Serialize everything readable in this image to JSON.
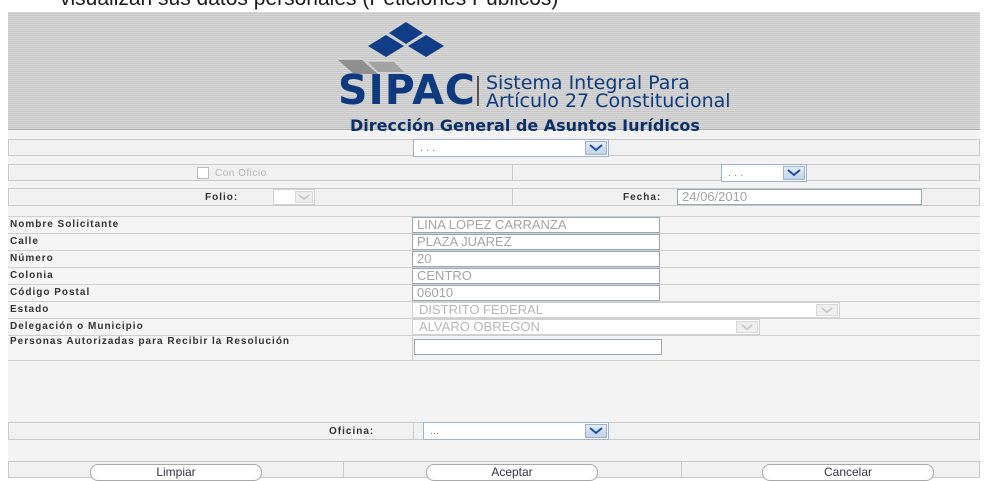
{
  "caption": "visualizan sus datos personales (Peticiones Públicos)",
  "header": {
    "brand": "SIPAC",
    "system_line1": "Sistema Integral Para",
    "system_line2": "Artículo 27 Constitucional",
    "subtitle": "Dirección General de Asuntos Jurídicos"
  },
  "top_select": {
    "value": ". . ."
  },
  "con_oficio": {
    "label": "Con Oficio",
    "checked": false
  },
  "right_select": {
    "value": ". . ."
  },
  "folio": {
    "label": "Folio:",
    "value": ""
  },
  "fecha": {
    "label": "Fecha:",
    "value": "24/06/2010"
  },
  "fields": [
    {
      "label": "Nombre Solicitante",
      "value": "LINA LOPEZ CARRANZA"
    },
    {
      "label": "Calle",
      "value": "PLAZA JUAREZ"
    },
    {
      "label": "Número",
      "value": "20"
    },
    {
      "label": "Colonia",
      "value": "CENTRO"
    },
    {
      "label": "Código Postal",
      "value": "06010"
    },
    {
      "label": "Estado",
      "value": "DISTRITO FEDERAL"
    },
    {
      "label": "Delegación o Municipio",
      "value": "ALVARO OBREGON"
    },
    {
      "label": "Personas Autorizadas para Recibir la Resolución",
      "value": ""
    }
  ],
  "oficina": {
    "label": "Oficina:",
    "value": "..."
  },
  "buttons": {
    "clear": "Limpiar",
    "accept": "Aceptar",
    "cancel": "Cancelar"
  },
  "colors": {
    "brand_blue": "#0d3a7e",
    "select_border": "#9fb2cb"
  }
}
